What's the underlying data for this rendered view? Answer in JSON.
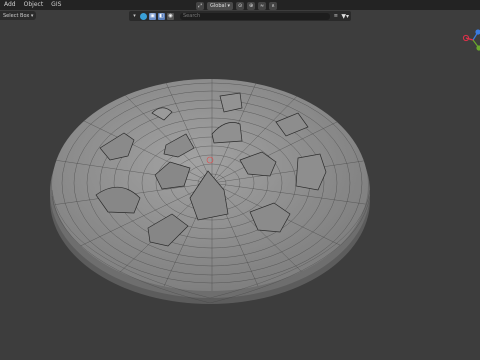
{
  "menu": {
    "items": [
      "Add",
      "Object",
      "GIS"
    ]
  },
  "header": {
    "orientation": "Global",
    "select_mode": "Select Box"
  },
  "outliner": {
    "search_placeholder": "Search"
  },
  "icons": [
    "chevron-down-icon",
    "sphere-icon",
    "restrict-select-icon",
    "hide-viewport-icon",
    "render-icon",
    "transform-icon",
    "snap-icon",
    "proportional-icon",
    "filter-icon",
    "axis-gizmo"
  ],
  "colors": {
    "background": "#3d3d3d",
    "mesh": "#8e8e8e",
    "wire": "#2e2e2e",
    "axis_x": "#e0304a",
    "axis_y": "#6aa82c",
    "axis_z": "#3a7be0"
  }
}
